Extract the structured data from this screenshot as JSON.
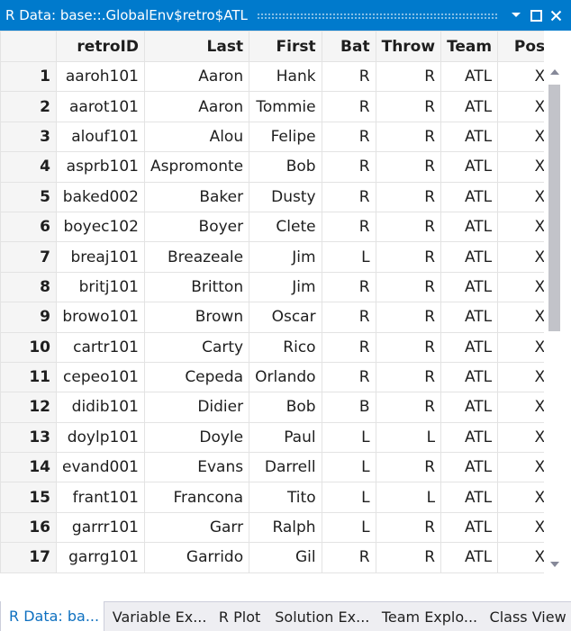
{
  "window": {
    "title": "R Data: base::.GlobalEnv$retro$ATL",
    "controls": {
      "dropdown_icon": "chevron-down-icon",
      "maximize_icon": "maximize-icon",
      "close_icon": "close-icon"
    }
  },
  "table": {
    "columns": [
      "",
      "retroID",
      "Last",
      "First",
      "Bat",
      "Throw",
      "Team",
      "Pos"
    ],
    "rows": [
      [
        "1",
        "aaroh101",
        "Aaron",
        "Hank",
        "R",
        "R",
        "ATL",
        "X"
      ],
      [
        "2",
        "aarot101",
        "Aaron",
        "Tommie",
        "R",
        "R",
        "ATL",
        "X"
      ],
      [
        "3",
        "alouf101",
        "Alou",
        "Felipe",
        "R",
        "R",
        "ATL",
        "X"
      ],
      [
        "4",
        "asprb101",
        "Aspromonte",
        "Bob",
        "R",
        "R",
        "ATL",
        "X"
      ],
      [
        "5",
        "baked002",
        "Baker",
        "Dusty",
        "R",
        "R",
        "ATL",
        "X"
      ],
      [
        "6",
        "boyec102",
        "Boyer",
        "Clete",
        "R",
        "R",
        "ATL",
        "X"
      ],
      [
        "7",
        "breaj101",
        "Breazeale",
        "Jim",
        "L",
        "R",
        "ATL",
        "X"
      ],
      [
        "8",
        "britj101",
        "Britton",
        "Jim",
        "R",
        "R",
        "ATL",
        "X"
      ],
      [
        "9",
        "browo101",
        "Brown",
        "Oscar",
        "R",
        "R",
        "ATL",
        "X"
      ],
      [
        "10",
        "cartr101",
        "Carty",
        "Rico",
        "R",
        "R",
        "ATL",
        "X"
      ],
      [
        "11",
        "cepeo101",
        "Cepeda",
        "Orlando",
        "R",
        "R",
        "ATL",
        "X"
      ],
      [
        "12",
        "didib101",
        "Didier",
        "Bob",
        "B",
        "R",
        "ATL",
        "X"
      ],
      [
        "13",
        "doylp101",
        "Doyle",
        "Paul",
        "L",
        "L",
        "ATL",
        "X"
      ],
      [
        "14",
        "evand001",
        "Evans",
        "Darrell",
        "L",
        "R",
        "ATL",
        "X"
      ],
      [
        "15",
        "frant101",
        "Francona",
        "Tito",
        "L",
        "L",
        "ATL",
        "X"
      ],
      [
        "16",
        "garrr101",
        "Garr",
        "Ralph",
        "L",
        "R",
        "ATL",
        "X"
      ],
      [
        "17",
        "garrg101",
        "Garrido",
        "Gil",
        "R",
        "R",
        "ATL",
        "X"
      ]
    ]
  },
  "tabs": [
    {
      "label": "R Data: ba...",
      "active": true
    },
    {
      "label": "Variable Ex...",
      "active": false
    },
    {
      "label": "R Plot",
      "active": false
    },
    {
      "label": "Solution Ex...",
      "active": false
    },
    {
      "label": "Team Explo...",
      "active": false
    },
    {
      "label": "Class View",
      "active": false
    }
  ],
  "colors": {
    "titlebar": "#007acc",
    "active_tab_text": "#0e70c0",
    "header_bg": "#f5f5f5",
    "grid_line": "#e3e3e3",
    "scroll_thumb": "#c2c3c9"
  }
}
